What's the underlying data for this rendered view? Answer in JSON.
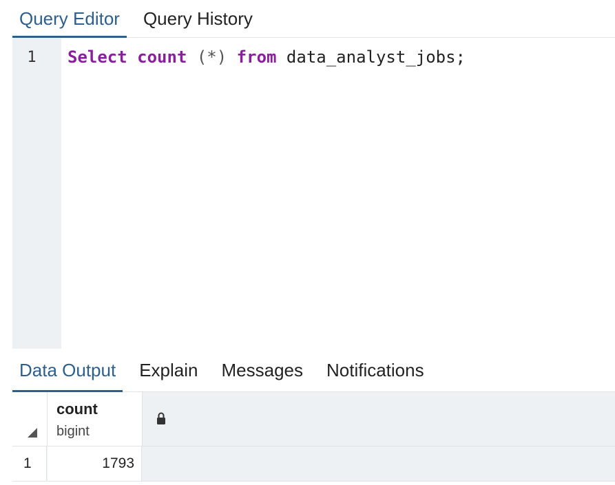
{
  "editor_tabs": [
    {
      "label": "Query Editor",
      "active": true
    },
    {
      "label": "Query History",
      "active": false
    }
  ],
  "editor": {
    "line_number": "1",
    "tokens": {
      "select": "Select",
      "count": "count",
      "paren": "(*)",
      "from": "from",
      "table": "data_analyst_jobs;"
    }
  },
  "output_tabs": [
    {
      "label": "Data Output",
      "active": true
    },
    {
      "label": "Explain",
      "active": false
    },
    {
      "label": "Messages",
      "active": false
    },
    {
      "label": "Notifications",
      "active": false
    }
  ],
  "grid": {
    "columns": [
      {
        "name": "count",
        "type": "bigint",
        "icon": "lock-icon"
      }
    ],
    "rows": [
      {
        "row_number": "1",
        "values": [
          "1793"
        ]
      }
    ]
  },
  "colors": {
    "accent": "#2c5f8d",
    "keyword": "#8a1f9e",
    "panel_bg": "#eef1f4"
  }
}
